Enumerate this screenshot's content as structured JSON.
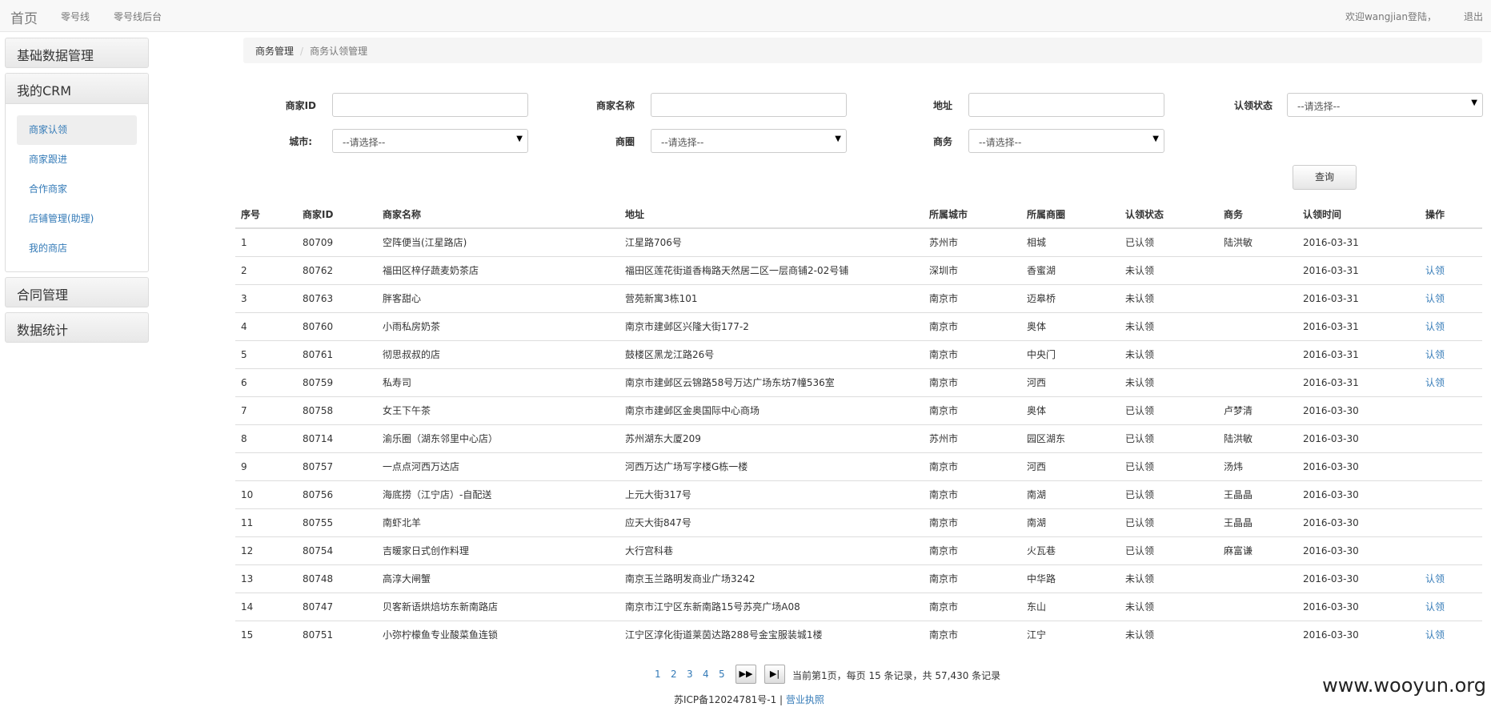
{
  "navbar": {
    "brand": "首页",
    "links": [
      "零号线",
      "零号线后台"
    ],
    "welcome": "欢迎wangjian登陆，",
    "logout": "退出"
  },
  "sidebar": {
    "base_data": "基础数据管理",
    "crm": "我的CRM",
    "crm_items": [
      "商家认领",
      "商家跟进",
      "合作商家",
      "店铺管理(助理)",
      "我的商店"
    ],
    "contract": "合同管理",
    "stats": "数据统计"
  },
  "breadcrumb": {
    "parent": "商务管理",
    "sep": "/",
    "current": "商务认领管理"
  },
  "filters": {
    "merchant_id": "商家ID",
    "merchant_name": "商家名称",
    "address": "地址",
    "claim_status": "认领状态",
    "city": "城市:",
    "area": "商圈",
    "bd": "商务",
    "select_placeholder": "--请选择--",
    "query": "查询"
  },
  "table": {
    "headers": [
      "序号",
      "商家ID",
      "商家名称",
      "地址",
      "所属城市",
      "所属商圈",
      "认领状态",
      "商务",
      "认领时间",
      "操作"
    ],
    "rows": [
      [
        "1",
        "80709",
        "空阵便当(江星路店)",
        "江星路706号",
        "苏州市",
        "相城",
        "已认领",
        "陆洪敏",
        "2016-03-31",
        ""
      ],
      [
        "2",
        "80762",
        "福田区梓仔蔬麦奶茶店",
        "福田区莲花街道香梅路天然居二区一层商铺2-02号铺",
        "深圳市",
        "香蜜湖",
        "未认领",
        "",
        "2016-03-31",
        "认领"
      ],
      [
        "3",
        "80763",
        "胖客甜心",
        "营苑新寓3栋101",
        "南京市",
        "迈皋桥",
        "未认领",
        "",
        "2016-03-31",
        "认领"
      ],
      [
        "4",
        "80760",
        "小雨私房奶茶",
        "南京市建邺区兴隆大街177-2",
        "南京市",
        "奥体",
        "未认领",
        "",
        "2016-03-31",
        "认领"
      ],
      [
        "5",
        "80761",
        "彻思叔叔的店",
        "鼓楼区黑龙江路26号",
        "南京市",
        "中央门",
        "未认领",
        "",
        "2016-03-31",
        "认领"
      ],
      [
        "6",
        "80759",
        "私寿司",
        "南京市建邺区云锦路58号万达广场东坊7幢536室",
        "南京市",
        "河西",
        "未认领",
        "",
        "2016-03-31",
        "认领"
      ],
      [
        "7",
        "80758",
        "女王下午茶",
        "南京市建邺区金奥国际中心商场",
        "南京市",
        "奥体",
        "已认领",
        "卢梦清",
        "2016-03-30",
        ""
      ],
      [
        "8",
        "80714",
        "渝乐圈（湖东邻里中心店）",
        "苏州湖东大厦209",
        "苏州市",
        "园区湖东",
        "已认领",
        "陆洪敏",
        "2016-03-30",
        ""
      ],
      [
        "9",
        "80757",
        "一点点河西万达店",
        "河西万达广场写字楼G栋一楼",
        "南京市",
        "河西",
        "已认领",
        "汤炜",
        "2016-03-30",
        ""
      ],
      [
        "10",
        "80756",
        "海底捞（江宁店）-自配送",
        "上元大街317号",
        "南京市",
        "南湖",
        "已认领",
        "王晶晶",
        "2016-03-30",
        ""
      ],
      [
        "11",
        "80755",
        "南虾北羊",
        "应天大街847号",
        "南京市",
        "南湖",
        "已认领",
        "王晶晶",
        "2016-03-30",
        ""
      ],
      [
        "12",
        "80754",
        "吉暖家日式创作料理",
        "大行宫科巷",
        "南京市",
        "火瓦巷",
        "已认领",
        "麻富谦",
        "2016-03-30",
        ""
      ],
      [
        "13",
        "80748",
        "高淳大闸蟹",
        "南京玉兰路明发商业广场3242",
        "南京市",
        "中华路",
        "未认领",
        "",
        "2016-03-30",
        "认领"
      ],
      [
        "14",
        "80747",
        "贝客新语烘焙坊东新南路店",
        "南京市江宁区东新南路15号苏亮广场A08",
        "南京市",
        "东山",
        "未认领",
        "",
        "2016-03-30",
        "认领"
      ],
      [
        "15",
        "80751",
        "小弥柠檬鱼专业酸菜鱼连锁",
        "江宁区淳化街道莱茵达路288号金宝服装城1楼",
        "南京市",
        "江宁",
        "未认领",
        "",
        "2016-03-30",
        "认领"
      ]
    ]
  },
  "pager": {
    "pages": [
      "1",
      "2",
      "3",
      "4",
      "5"
    ],
    "next_icon": "▶▶",
    "last_icon": "▶|",
    "info": "当前第1页，每页 15 条记录，共 57,430 条记录"
  },
  "footer": {
    "icp": "苏ICP备12024781号-1 | ",
    "license": "营业执照"
  },
  "watermark": "www.wooyun.org"
}
